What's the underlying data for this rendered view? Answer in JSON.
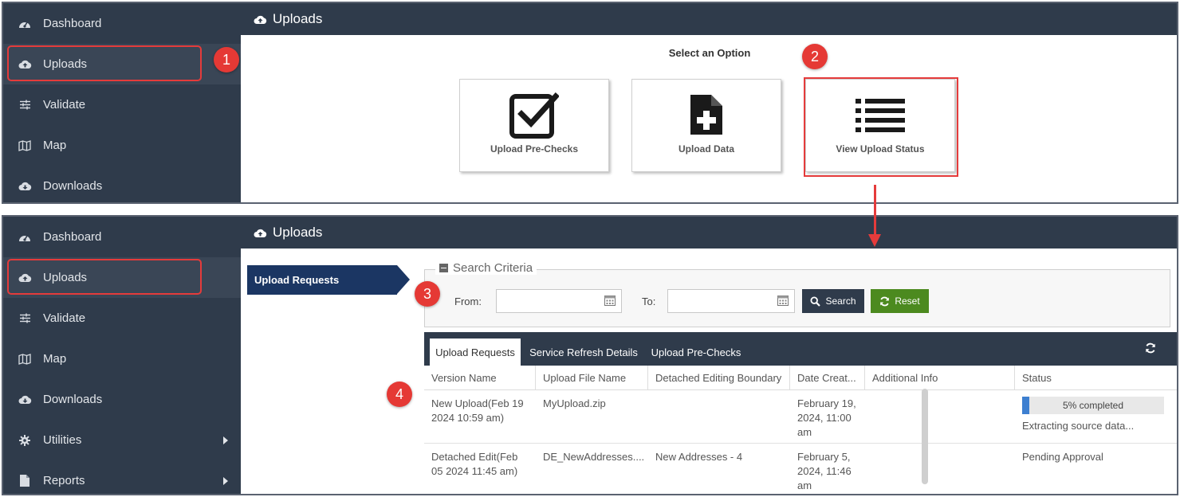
{
  "sidebar_top": {
    "items": [
      {
        "label": "Dashboard",
        "icon": "dashboard-icon"
      },
      {
        "label": "Uploads",
        "icon": "cloud-upload-icon"
      },
      {
        "label": "Validate",
        "icon": "sliders-icon"
      },
      {
        "label": "Map",
        "icon": "map-icon"
      },
      {
        "label": "Downloads",
        "icon": "cloud-download-icon"
      }
    ]
  },
  "sidebar_bottom": {
    "items": [
      {
        "label": "Dashboard",
        "icon": "dashboard-icon"
      },
      {
        "label": "Uploads",
        "icon": "cloud-upload-icon"
      },
      {
        "label": "Validate",
        "icon": "sliders-icon"
      },
      {
        "label": "Map",
        "icon": "map-icon"
      },
      {
        "label": "Downloads",
        "icon": "cloud-download-icon"
      },
      {
        "label": "Utilities",
        "icon": "gear-icon"
      },
      {
        "label": "Reports",
        "icon": "document-icon"
      }
    ]
  },
  "header": {
    "title": "Uploads",
    "icon": "cloud-upload-icon"
  },
  "callouts": [
    "1",
    "2",
    "3",
    "4"
  ],
  "options": {
    "title": "Select an Option",
    "cards": [
      {
        "label": "Upload Pre-Checks",
        "icon": "checkbox-icon"
      },
      {
        "label": "Upload Data",
        "icon": "file-plus-icon"
      },
      {
        "label": "View Upload Status",
        "icon": "list-icon"
      }
    ]
  },
  "status_page": {
    "left_tab": "Upload Requests",
    "search": {
      "legend": "Search Criteria",
      "from_label": "From:",
      "to_label": "To:",
      "from_value": "",
      "to_value": "",
      "search_label": "Search",
      "reset_label": "Reset"
    },
    "tabs": [
      "Upload Requests",
      "Service Refresh Details",
      "Upload Pre-Checks"
    ],
    "columns": [
      "Version Name",
      "Upload File Name",
      "Detached Editing Boundary",
      "Date Creat...",
      "Additional Info",
      "Status"
    ],
    "rows": [
      {
        "version": "New Upload(Feb 19 2024 10:59 am)",
        "file": "MyUpload.zip",
        "boundary": "",
        "date": "February 19, 2024, 11:00 am",
        "info": "",
        "progress": 0.05,
        "progress_text": "5% completed",
        "status": "Extracting source data..."
      },
      {
        "version": "Detached Edit(Feb 05 2024 11:45 am)",
        "file": "DE_NewAddresses....",
        "boundary": "New Addresses - 4",
        "date": "February 5, 2024, 11:46 am",
        "info": "",
        "status": "Pending Approval"
      }
    ]
  },
  "colors": {
    "sidebar_bg": "#2f3b4b",
    "highlight_red": "#e53b3b",
    "badge_red": "#e53935",
    "nav_blue": "#1b3663",
    "search_btn": "#2f3b4b",
    "reset_btn": "#4c8a1f",
    "progress_blue": "#3d7fd0"
  }
}
